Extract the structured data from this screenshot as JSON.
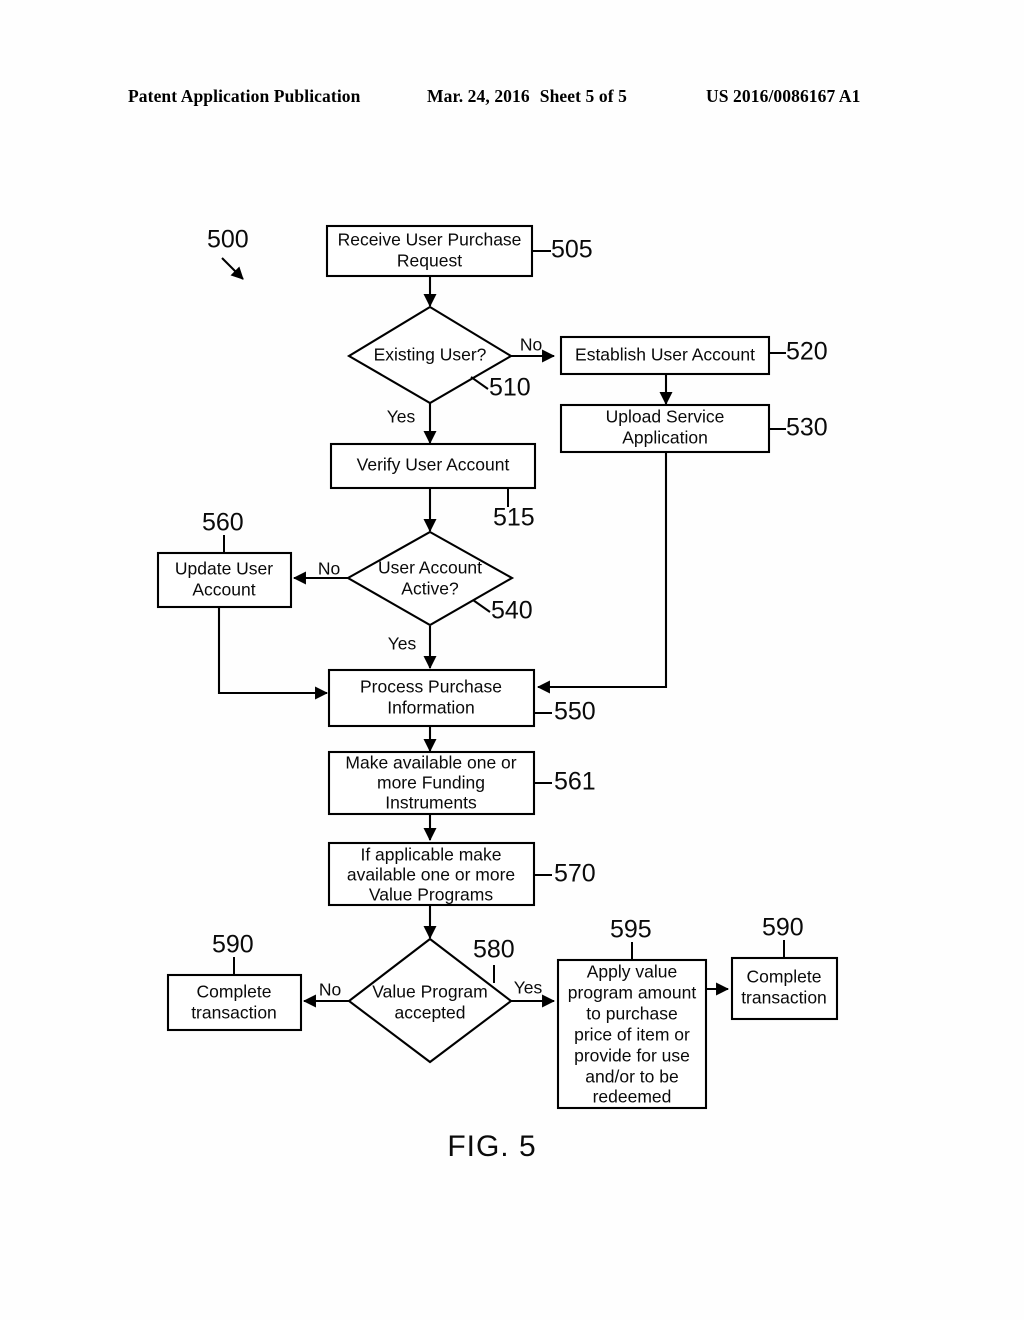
{
  "header": {
    "left": "Patent Application Publication",
    "date": "Mar. 24, 2016",
    "sheet": "Sheet 5 of 5",
    "publication_number": "US 2016/0086167 A1"
  },
  "figure": {
    "caption": "FIG. 5",
    "diagram_ref": "500"
  },
  "nodes": {
    "n505": {
      "ref": "505",
      "lines": [
        "Receive User Purchase",
        "Request"
      ]
    },
    "n510": {
      "ref": "510",
      "lines": [
        "Existing User?"
      ]
    },
    "n520": {
      "ref": "520",
      "lines": [
        "Establish User Account"
      ]
    },
    "n530": {
      "ref": "530",
      "lines": [
        "Upload Service",
        "Application"
      ]
    },
    "n515": {
      "ref": "515",
      "lines": [
        "Verify User Account"
      ]
    },
    "n540": {
      "ref": "540",
      "lines": [
        "User Account",
        "Active?"
      ]
    },
    "n560": {
      "ref": "560",
      "lines": [
        "Update User",
        "Account"
      ]
    },
    "n550": {
      "ref": "550",
      "lines": [
        "Process Purchase",
        "Information"
      ]
    },
    "n561": {
      "ref": "561",
      "lines": [
        "Make available one or",
        "more Funding",
        "Instruments"
      ]
    },
    "n570": {
      "ref": "570",
      "lines": [
        "If applicable make",
        "available one or more",
        "Value Programs"
      ]
    },
    "n580": {
      "ref": "580",
      "lines": [
        "Value Program",
        "accepted"
      ]
    },
    "n590_left": {
      "ref": "590",
      "lines": [
        "Complete",
        "transaction"
      ]
    },
    "n595": {
      "ref": "595",
      "lines": [
        "Apply value",
        "program amount",
        "to purchase",
        "price of item or",
        "provide for use",
        "and/or to be",
        "redeemed"
      ]
    },
    "n590_right": {
      "ref": "590",
      "lines": [
        "Complete",
        "transaction"
      ]
    }
  },
  "branches": {
    "existing_user_no": "No",
    "existing_user_yes": "Yes",
    "account_active_no": "No",
    "account_active_yes": "Yes",
    "value_program_no": "No",
    "value_program_yes": "Yes"
  },
  "colors": {
    "ink": "#000000",
    "paper": "#ffffff"
  }
}
